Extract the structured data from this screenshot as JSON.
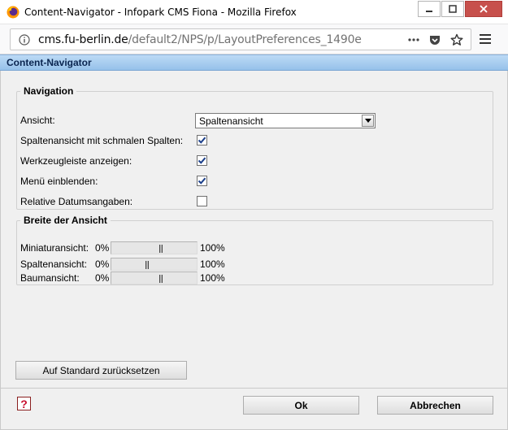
{
  "window": {
    "title": "Content-Navigator - Infopark CMS Fiona - Mozilla Firefox"
  },
  "urlbar": {
    "host": "cms.fu-berlin.de",
    "path": "/default2/NPS/p/LayoutPreferences_1490e"
  },
  "dialog": {
    "header": "Content-Navigator"
  },
  "navigation": {
    "legend": "Navigation",
    "view_label": "Ansicht:",
    "view_value": "Spaltenansicht",
    "options": [
      {
        "label": "Spaltenansicht mit schmalen Spalten:",
        "checked": true
      },
      {
        "label": "Werkzeugleiste anzeigen:",
        "checked": true
      },
      {
        "label": "Menü einblenden:",
        "checked": true
      },
      {
        "label": "Relative Datumsangaben:",
        "checked": false
      }
    ]
  },
  "width": {
    "legend": "Breite der Ansicht",
    "min_label": "0%",
    "max_label": "100%",
    "sliders": [
      {
        "label": "Miniaturansicht:",
        "value_fraction": 0.6
      },
      {
        "label": "Spaltenansicht:",
        "value_fraction": 0.42
      },
      {
        "label": "Baumansicht:",
        "value_fraction": 0.6
      }
    ]
  },
  "buttons": {
    "reset": "Auf Standard zurücksetzen",
    "ok": "Ok",
    "cancel": "Abbrechen"
  },
  "colors": {
    "header_gradient_top": "#bcdaf5",
    "header_gradient_bottom": "#96c1ea",
    "close_button": "#c7504c",
    "dialog_bg": "#f0f0f0"
  },
  "icons": {
    "browser_logo": "firefox-icon",
    "help": "help-icon",
    "url_info": "info-icon"
  }
}
